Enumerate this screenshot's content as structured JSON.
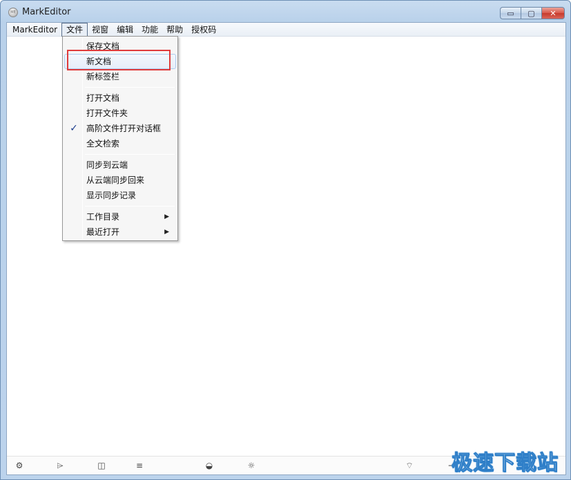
{
  "window": {
    "title": "MarkEditor",
    "app_icon": "ME"
  },
  "caption_buttons": {
    "minimize": "▭",
    "maximize": "▢",
    "close": "✕"
  },
  "menubar": {
    "items": [
      "MarkEditor",
      "文件",
      "视窗",
      "编辑",
      "功能",
      "帮助",
      "授权码"
    ]
  },
  "file_menu": {
    "items": [
      {
        "label": "保存文档"
      },
      {
        "label": "新文档"
      },
      {
        "label": "新标签栏"
      },
      {
        "label": "打开文档"
      },
      {
        "label": "打开文件夹"
      },
      {
        "label": "高阶文件打开对话框",
        "checked": true
      },
      {
        "label": "全文检索"
      },
      {
        "label": "同步到云端"
      },
      {
        "label": "从云端同步回来"
      },
      {
        "label": "显示同步记录"
      },
      {
        "label": "工作目录",
        "submenu": true
      },
      {
        "label": "最近打开",
        "submenu": true
      }
    ],
    "check_glyph": "✓",
    "submenu_glyph": "▶"
  },
  "bottom_toolbar": {
    "icons": [
      {
        "name": "gear-icon",
        "glyph": "⚙"
      },
      {
        "name": "folder-open-icon",
        "glyph": "⌲"
      },
      {
        "name": "split-view-icon",
        "glyph": "◫"
      },
      {
        "name": "list-menu-icon",
        "glyph": "≡"
      },
      {
        "name": "theme-contrast-icon",
        "glyph": "◒"
      },
      {
        "name": "lightbulb-icon",
        "glyph": "☼"
      },
      {
        "name": "wifi-icon",
        "glyph": "⌔"
      },
      {
        "name": "export-icon",
        "glyph": "⇥"
      }
    ]
  },
  "watermark": "极速下载站"
}
